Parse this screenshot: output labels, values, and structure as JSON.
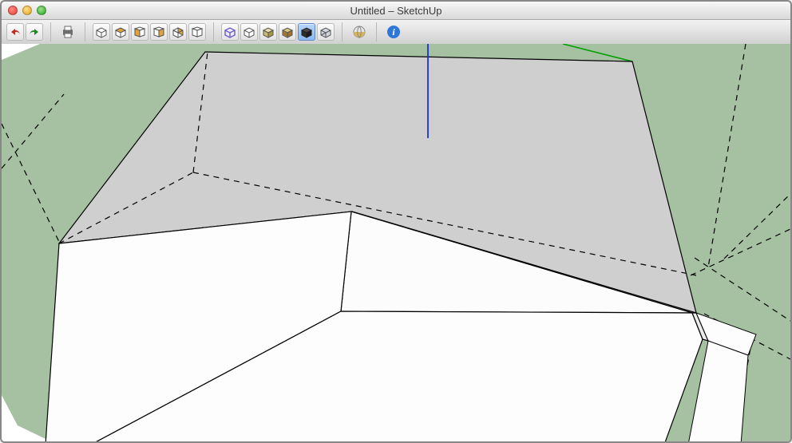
{
  "window": {
    "title": "Untitled – SketchUp"
  },
  "toolbar": {
    "undo": "Undo",
    "redo": "Redo",
    "print": "Print",
    "view_iso": "Iso",
    "view_top": "Top",
    "view_front": "Front",
    "view_right": "Right",
    "view_back": "Back",
    "view_left": "Left",
    "style_wire": "Wireframe",
    "style_hidden": "Hidden Line",
    "style_shaded": "Shaded",
    "style_shaded_tex": "Shaded With Textures",
    "style_mono": "Monochrome",
    "style_xray": "X-Ray",
    "warehouse": "3D Warehouse",
    "info": "Info"
  },
  "colors": {
    "ground": "#a6c1a1",
    "face_top": "#cfcfcf",
    "face_front": "#fdfdfd",
    "axis_z": "#1c2edd",
    "axis_y": "#00a000"
  }
}
